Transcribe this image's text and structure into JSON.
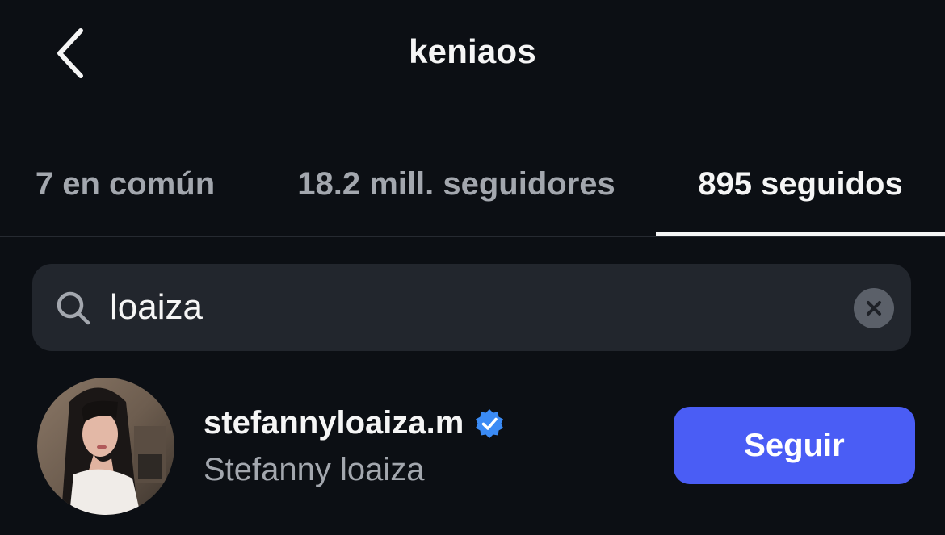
{
  "header": {
    "title": "keniaos",
    "back_icon": "chevron-left-icon"
  },
  "tabs": [
    {
      "label": "7 en común",
      "active": false
    },
    {
      "label": "18.2 mill. seguidores",
      "active": false
    },
    {
      "label": "895 seguidos",
      "active": true
    }
  ],
  "search": {
    "value": "loaiza",
    "placeholder": "",
    "icon": "search-icon",
    "clear_icon": "clear-icon"
  },
  "results": [
    {
      "username": "stefannyloaiza.m",
      "verified": true,
      "full_name": "Stefanny loaiza",
      "action_label": "Seguir"
    }
  ],
  "colors": {
    "background": "#0c0f14",
    "active_tab": "#f5f5f5",
    "inactive_tab": "#a3a7ae",
    "search_bg": "#22262d",
    "follow_button": "#4a5df5",
    "verified_badge": "#3b8bf5"
  }
}
